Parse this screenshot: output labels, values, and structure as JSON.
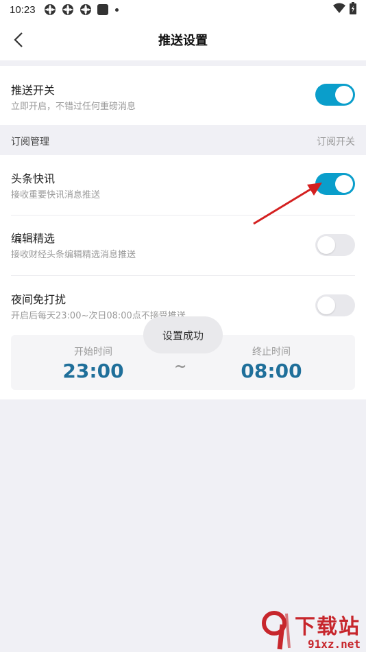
{
  "status_bar": {
    "time": "10:23",
    "icons": [
      "sync-icon",
      "sync-icon",
      "sync-icon",
      "app-square-icon",
      "dot-icon"
    ],
    "right_icons": [
      "wifi-icon",
      "battery-icon"
    ]
  },
  "nav": {
    "title": "推送设置",
    "back_icon": "chevron-left-icon"
  },
  "push_switch": {
    "label": "推送开关",
    "sub": "立即开启，不错过任何重磅消息",
    "enabled": true
  },
  "subscription": {
    "header_left": "订阅管理",
    "header_right": "订阅开关",
    "items": [
      {
        "label": "头条快讯",
        "sub": "接收重要快讯消息推送",
        "enabled": true
      },
      {
        "label": "编辑精选",
        "sub": "接收财经头条编辑精选消息推送",
        "enabled": false
      },
      {
        "label": "夜间免打扰",
        "sub": "开启后每天23:00~次日08:00点不接受推送",
        "enabled": false
      }
    ]
  },
  "quiet_hours": {
    "start_label": "开始时间",
    "start_value": "23:00",
    "separator": "~",
    "end_label": "终止时间",
    "end_value": "08:00"
  },
  "toast": {
    "text": "设置成功"
  },
  "colors": {
    "accent": "#0a9ecb",
    "time_value": "#1f6f9a",
    "annotation_arrow": "#d42020",
    "watermark": "#c7262c"
  },
  "watermark": {
    "top": "下载站",
    "bottom": "91xz.net"
  }
}
